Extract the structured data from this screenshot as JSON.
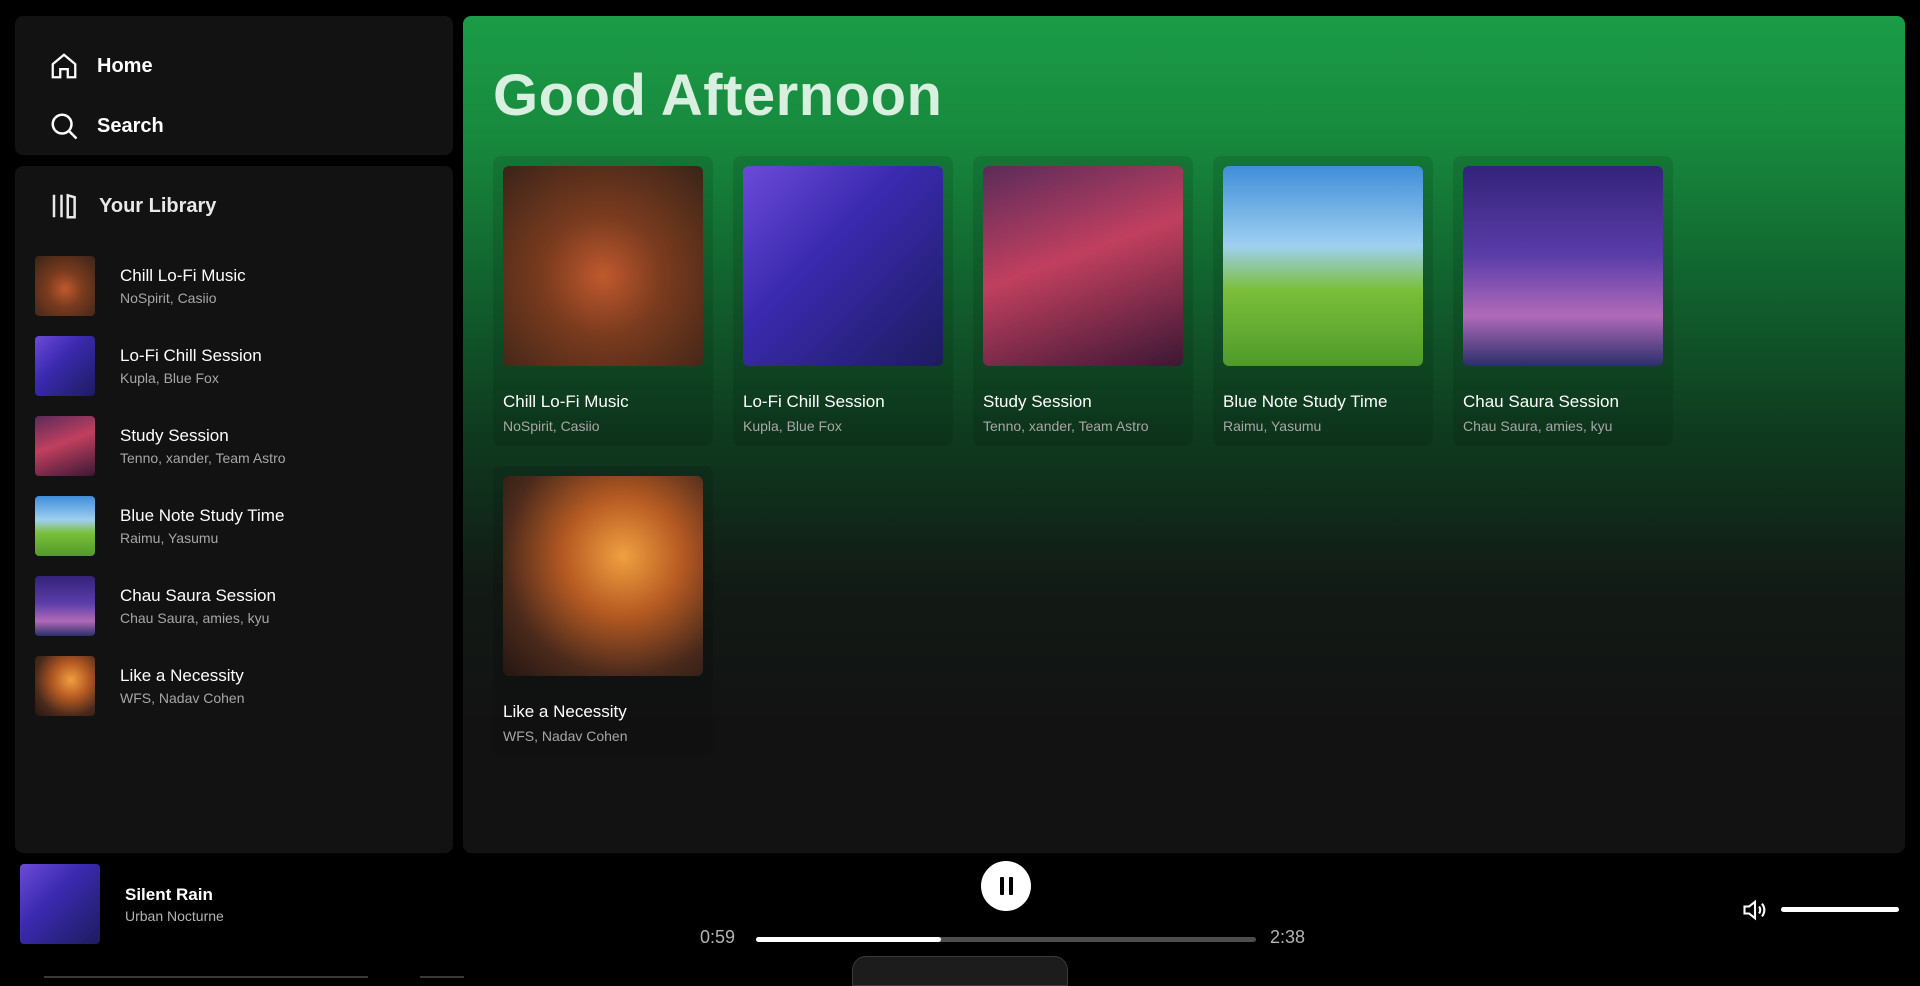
{
  "nav": {
    "home": "Home",
    "search": "Search"
  },
  "library": {
    "title": "Your Library",
    "items": [
      {
        "title": "Chill Lo-Fi Music",
        "artists": "NoSpirit, Casiio"
      },
      {
        "title": "Lo-Fi Chill Session",
        "artists": "Kupla, Blue Fox"
      },
      {
        "title": "Study Session",
        "artists": "Tenno, xander, Team Astro"
      },
      {
        "title": "Blue Note Study Time",
        "artists": "Raimu, Yasumu"
      },
      {
        "title": "Chau Saura Session",
        "artists": "Chau Saura, amies, kyu"
      },
      {
        "title": "Like a Necessity",
        "artists": "WFS, Nadav Cohen"
      }
    ]
  },
  "main": {
    "greeting": "Good Afternoon",
    "cards": [
      {
        "title": "Chill Lo-Fi Music",
        "artists": "NoSpirit, Casiio"
      },
      {
        "title": "Lo-Fi Chill Session",
        "artists": "Kupla, Blue Fox"
      },
      {
        "title": "Study Session",
        "artists": "Tenno, xander, Team Astro"
      },
      {
        "title": "Blue Note Study Time",
        "artists": "Raimu, Yasumu"
      },
      {
        "title": "Chau Saura Session",
        "artists": "Chau Saura, amies, kyu"
      },
      {
        "title": "Like a Necessity",
        "artists": "WFS, Nadav Cohen"
      }
    ]
  },
  "player": {
    "track": "Silent Rain",
    "artist": "Urban Nocturne",
    "current_time": "0:59",
    "total_time": "2:38",
    "progress_fraction": 0.37,
    "volume_fraction": 1.0,
    "play_state": "playing"
  },
  "colors": {
    "accent": "#1db954",
    "background": "#121212",
    "text_secondary": "#a7a7a7"
  },
  "icons": {
    "home": "home-icon",
    "search": "search-icon",
    "library": "library-icon",
    "pause": "pause-icon",
    "volume": "volume-icon"
  }
}
